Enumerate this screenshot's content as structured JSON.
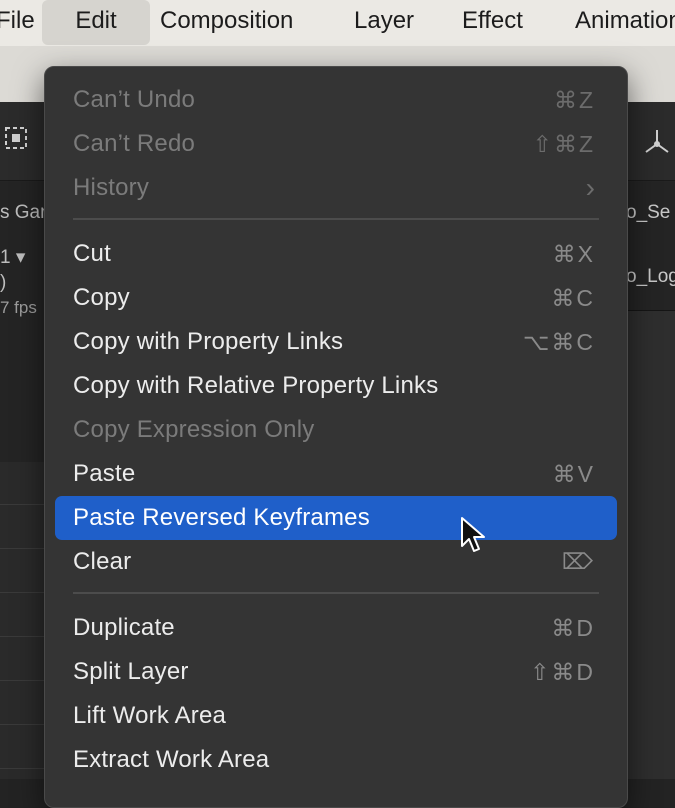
{
  "menubar": {
    "items": [
      {
        "label": "File"
      },
      {
        "label": "Edit"
      },
      {
        "label": "Composition"
      },
      {
        "label": "Layer"
      },
      {
        "label": "Effect"
      },
      {
        "label": "Animation"
      }
    ]
  },
  "background": {
    "left_panel": {
      "name_fragment": "s Gar",
      "value_fragment": "1",
      "paren_fragment": ")",
      "fps_fragment": "7 fps"
    },
    "right_panel": {
      "item1": "o_Se",
      "item2": "o_Log"
    }
  },
  "edit_menu": {
    "items": [
      {
        "label": "Can’t Undo",
        "shortcut": "⌘Z",
        "enabled": false
      },
      {
        "label": "Can’t Redo",
        "shortcut": "⇧⌘Z",
        "enabled": false
      },
      {
        "label": "History",
        "shortcut": "›",
        "enabled": false
      },
      {
        "label": "Cut",
        "shortcut": "⌘X",
        "enabled": true
      },
      {
        "label": "Copy",
        "shortcut": "⌘C",
        "enabled": true
      },
      {
        "label": "Copy with Property Links",
        "shortcut": "⌥⌘C",
        "enabled": true
      },
      {
        "label": "Copy with Relative Property Links",
        "shortcut": "",
        "enabled": true
      },
      {
        "label": "Copy Expression Only",
        "shortcut": "",
        "enabled": false
      },
      {
        "label": "Paste",
        "shortcut": "⌘V",
        "enabled": true
      },
      {
        "label": "Paste Reversed Keyframes",
        "shortcut": "",
        "enabled": true,
        "selected": true
      },
      {
        "label": "Clear",
        "shortcut": "⌦",
        "enabled": true
      },
      {
        "label": "Duplicate",
        "shortcut": "⌘D",
        "enabled": true
      },
      {
        "label": "Split Layer",
        "shortcut": "⇧⌘D",
        "enabled": true
      },
      {
        "label": "Lift Work Area",
        "shortcut": "",
        "enabled": true
      },
      {
        "label": "Extract Work Area",
        "shortcut": "",
        "enabled": true
      }
    ]
  },
  "colors": {
    "menu_bg": "#343434",
    "selection": "#1f5fc9",
    "menubar_bg": "#ebe9e4"
  }
}
